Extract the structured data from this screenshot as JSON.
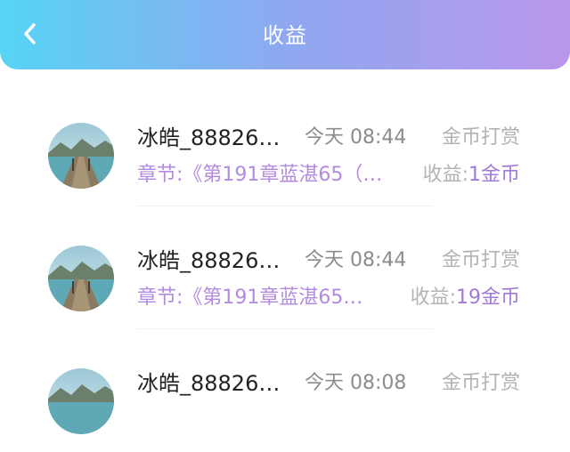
{
  "header": {
    "title": "收益",
    "back_icon": "chevron-left-icon",
    "gradient_start": "#56d4f5",
    "gradient_end": "#b996ec"
  },
  "records": [
    {
      "name": "冰皓_88826…",
      "time": "今天 08:44",
      "type": "金币打赏",
      "chapter": "章节:《第191章蓝湛65（…",
      "income_label": "收益:",
      "income_value": "1金币"
    },
    {
      "name": "冰皓_88826…",
      "time": "今天 08:44",
      "type": "金币打赏",
      "chapter": "章节:《第191章蓝湛65…",
      "income_label": "收益:",
      "income_value": "19金币"
    },
    {
      "name": "冰皓_88826…",
      "time": "今天 08:08",
      "type": "金币打赏",
      "chapter": "",
      "income_label": "",
      "income_value": ""
    }
  ]
}
